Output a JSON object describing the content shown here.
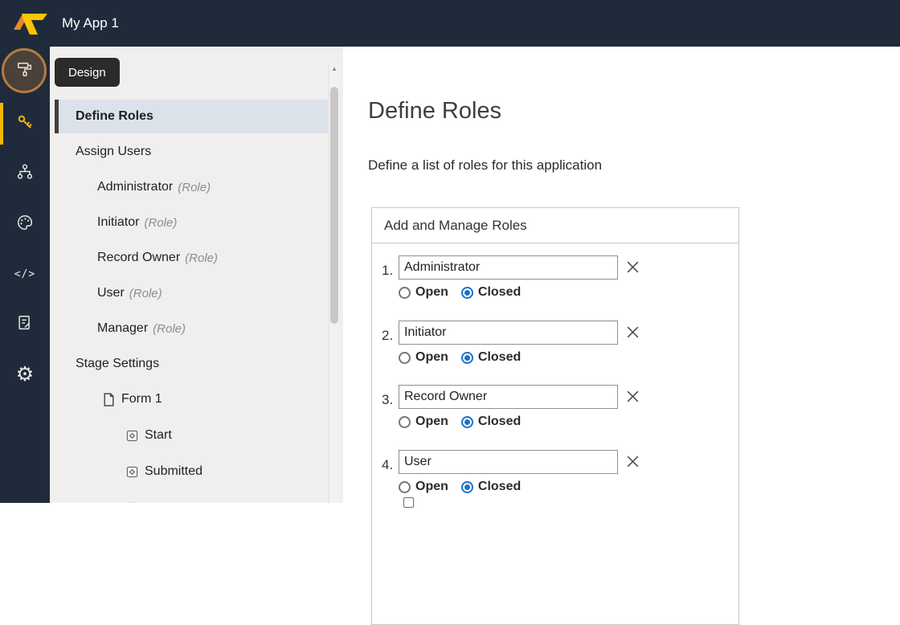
{
  "topbar": {
    "app_title": "My App 1"
  },
  "rail": {
    "items": [
      {
        "name": "design",
        "icon": "paint-roller-icon",
        "highlighted": true
      },
      {
        "name": "roles",
        "icon": "key-icon",
        "active": true
      },
      {
        "name": "workflow",
        "icon": "hierarchy-icon"
      },
      {
        "name": "theme",
        "icon": "palette-icon"
      },
      {
        "name": "code",
        "icon": "code-icon"
      },
      {
        "name": "forms",
        "icon": "form-icon"
      },
      {
        "name": "settings",
        "icon": "gear-icon"
      }
    ],
    "code_glyph": "</>",
    "gear_glyph": "⚙"
  },
  "sidebar": {
    "design_button": "Design",
    "scroll_up_glyph": "▲",
    "items": [
      {
        "label": "Define Roles",
        "level": 0,
        "selected": true
      },
      {
        "label": "Assign Users",
        "level": 0
      },
      {
        "label": "Administrator",
        "suffix": "(Role)",
        "level": 1
      },
      {
        "label": "Initiator",
        "suffix": "(Role)",
        "level": 1
      },
      {
        "label": "Record Owner",
        "suffix": "(Role)",
        "level": 1
      },
      {
        "label": "User",
        "suffix": "(Role)",
        "level": 1
      },
      {
        "label": "Manager",
        "suffix": "(Role)",
        "level": 1
      },
      {
        "label": "Stage Settings",
        "level": 0
      },
      {
        "label": "Form 1",
        "level": 1,
        "icon": "document-icon"
      },
      {
        "label": "Start",
        "level": 2,
        "icon": "stage-icon"
      },
      {
        "label": "Submitted",
        "level": 2,
        "icon": "stage-icon"
      }
    ]
  },
  "main": {
    "title": "Define Roles",
    "subtitle": "Define a list of roles for this application",
    "panel": {
      "header": "Add and Manage Roles",
      "roles": [
        {
          "index": "1.",
          "value": "Administrator",
          "open_label": "Open",
          "closed_label": "Closed",
          "selected": "Closed"
        },
        {
          "index": "2.",
          "value": "Initiator",
          "open_label": "Open",
          "closed_label": "Closed",
          "selected": "Closed"
        },
        {
          "index": "3.",
          "value": "Record Owner",
          "open_label": "Open",
          "closed_label": "Closed",
          "selected": "Closed"
        },
        {
          "index": "4.",
          "value": "User",
          "open_label": "Open",
          "closed_label": "Closed",
          "selected": "Closed"
        }
      ]
    }
  },
  "colors": {
    "topbar_bg": "#1f2b3a",
    "accent_yellow": "#f3b700",
    "selected_row_bg": "#dbe2e9",
    "radio_checked": "#1b72c8",
    "highlight_circle": "#b87a3e"
  }
}
